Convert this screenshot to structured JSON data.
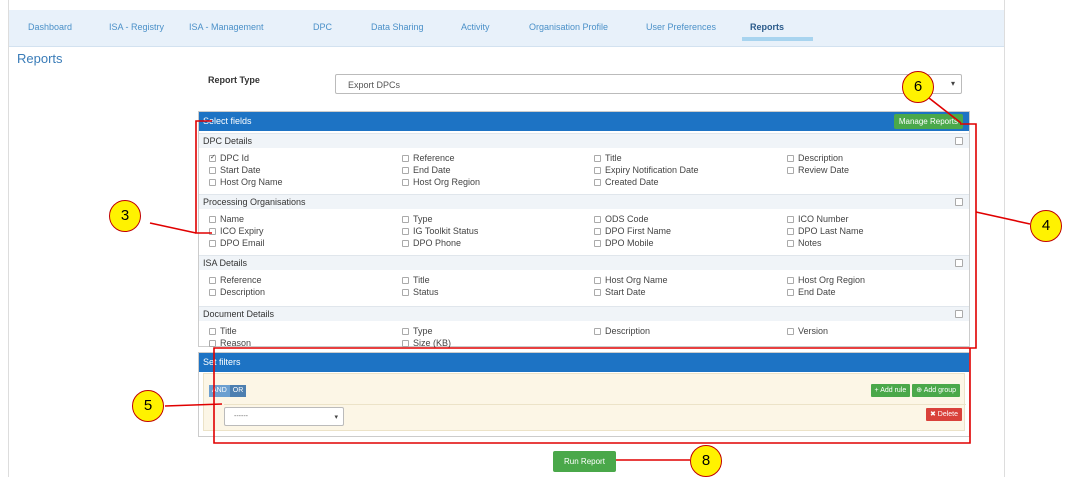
{
  "nav": {
    "items": [
      {
        "label": "Dashboard",
        "active": false
      },
      {
        "label": "ISA - Registry",
        "active": false
      },
      {
        "label": "ISA - Management",
        "active": false
      },
      {
        "label": "DPC",
        "active": false
      },
      {
        "label": "Data Sharing",
        "active": false
      },
      {
        "label": "Activity",
        "active": false
      },
      {
        "label": "Organisation Profile",
        "active": false
      },
      {
        "label": "User Preferences",
        "active": false
      },
      {
        "label": "Reports",
        "active": true
      }
    ]
  },
  "page": {
    "title": "Reports"
  },
  "report_type": {
    "label": "Report Type",
    "value": "Export DPCs"
  },
  "select_fields": {
    "title": "Select fields",
    "manage_label": "Manage Reports",
    "groups": [
      {
        "name": "DPC Details",
        "fields": [
          "DPC Id",
          "Reference",
          "Title",
          "Description",
          "Start Date",
          "End Date",
          "Expiry Notification Date",
          "Review Date",
          "Host Org Name",
          "Host Org Region",
          "Created Date"
        ]
      },
      {
        "name": "Processing Organisations",
        "fields": [
          "Name",
          "Type",
          "ODS Code",
          "ICO Number",
          "ICO Expiry",
          "IG Toolkit Status",
          "DPO First Name",
          "DPO Last Name",
          "DPO Email",
          "DPO Phone",
          "DPO Mobile",
          "Notes"
        ]
      },
      {
        "name": "ISA Details",
        "fields": [
          "Reference",
          "Title",
          "Host Org Name",
          "Host Org Region",
          "Description",
          "Status",
          "Start Date",
          "End Date"
        ]
      },
      {
        "name": "Document Details",
        "fields": [
          "Title",
          "Type",
          "Description",
          "Version",
          "Reason",
          "Size (KB)"
        ]
      }
    ],
    "checked": [
      "DPC Id"
    ]
  },
  "filters": {
    "title": "Set filters",
    "and_label": "AND",
    "or_label": "OR",
    "add_rule_label": "+ Add rule",
    "add_group_label": "⊕ Add group",
    "rule_select_value": "------",
    "delete_label": "✖ Delete"
  },
  "run_label": "Run Report",
  "annotations": [
    "3",
    "4",
    "5",
    "6",
    "8"
  ],
  "colors": {
    "accent": "#1d73c4",
    "success": "#4aa84a",
    "danger": "#d9413a",
    "callout_fill": "#fff200",
    "callout_stroke": "#c00000"
  }
}
